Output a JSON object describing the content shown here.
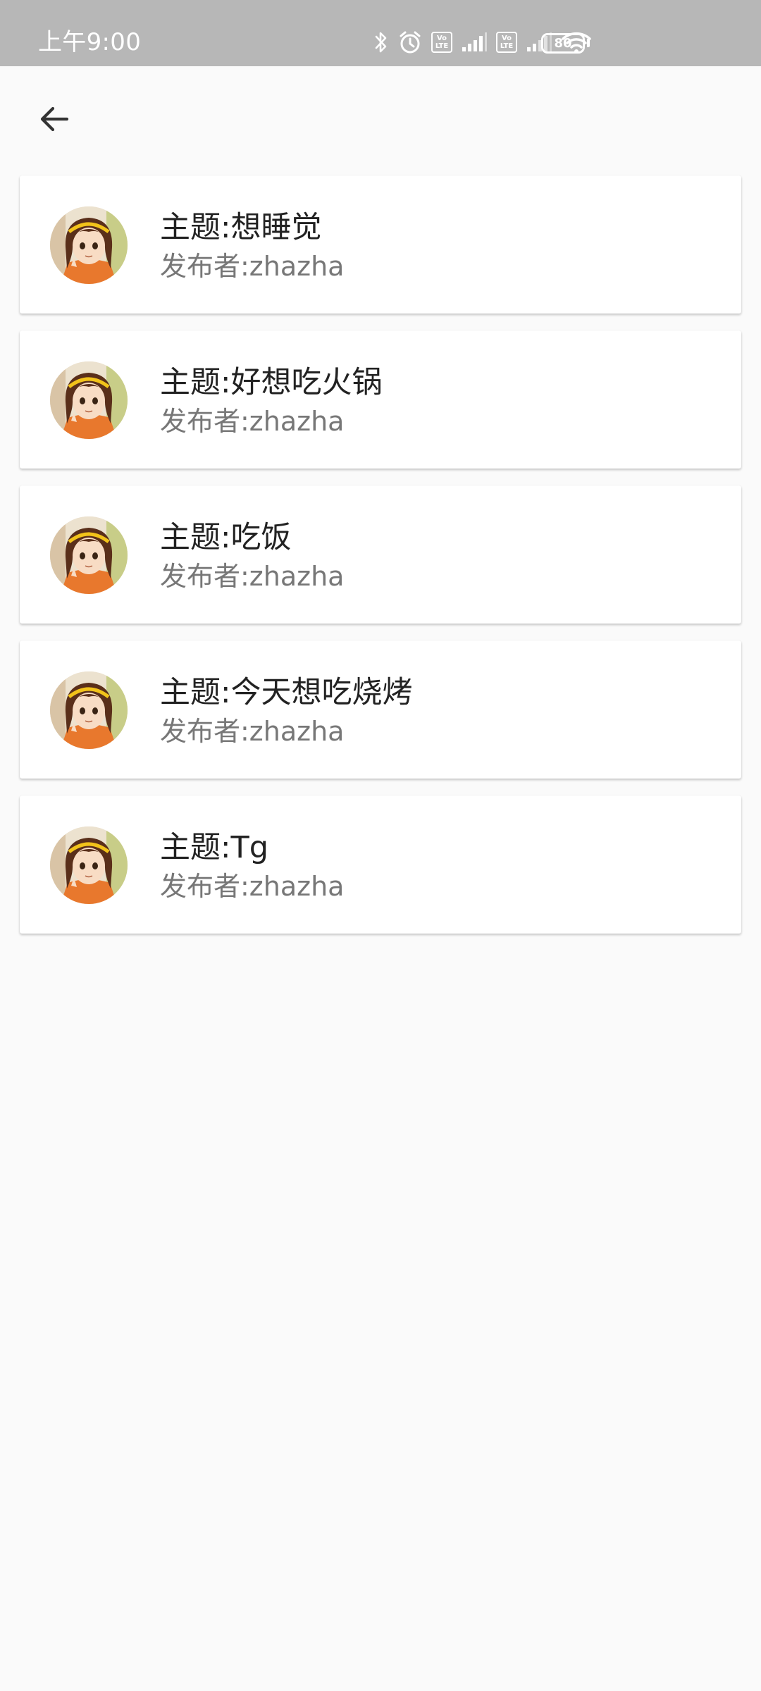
{
  "status_bar": {
    "time": "上午9:00",
    "battery": "80",
    "icons": [
      "bluetooth-icon",
      "alarm-icon",
      "volte-icon",
      "signal-icon",
      "volte-icon",
      "signal-icon",
      "wifi-icon",
      "battery-icon"
    ],
    "volte_top": "Vo",
    "volte_bottom": "LTE"
  },
  "app_bar": {
    "back_icon": "arrow-left-icon"
  },
  "topics": [
    {
      "title": "主题:想睡觉",
      "author": "发布者:zhazha"
    },
    {
      "title": "主题:好想吃火锅",
      "author": "发布者:zhazha"
    },
    {
      "title": "主题:吃饭",
      "author": "发布者:zhazha"
    },
    {
      "title": "主题:今天想吃烧烤",
      "author": "发布者:zhazha"
    },
    {
      "title": "主题:Tg",
      "author": "发布者:zhazha"
    }
  ],
  "colors": {
    "status_bar_bg": "#b7b7b7",
    "background": "#fafafa",
    "card_bg": "#ffffff",
    "title_text": "#222222",
    "author_text": "#777777"
  }
}
